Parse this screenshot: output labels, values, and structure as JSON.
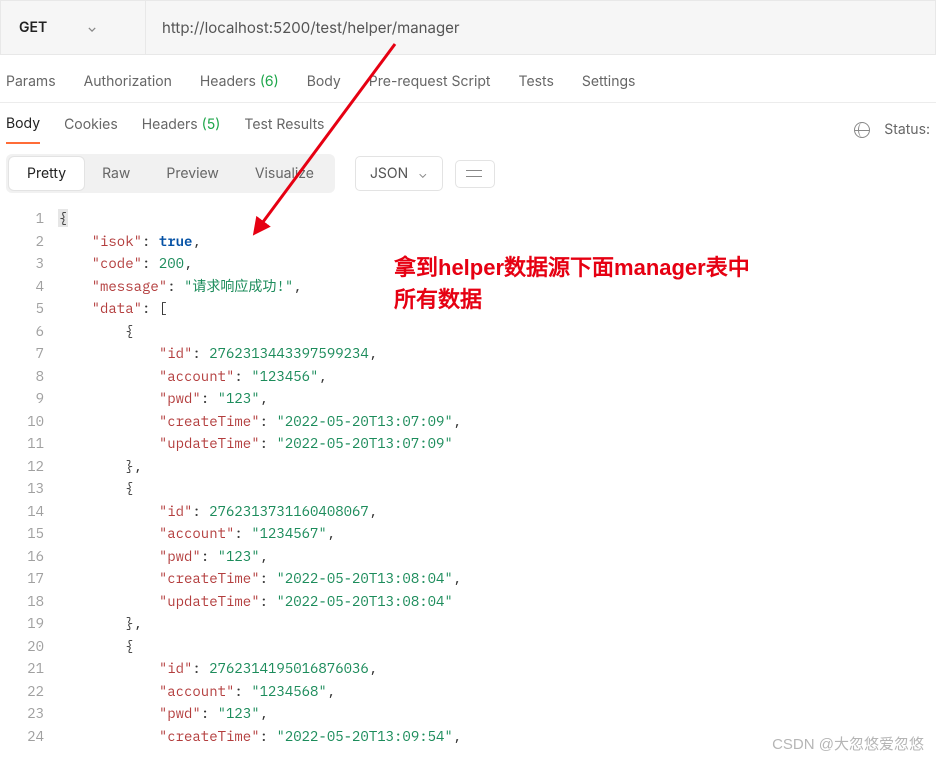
{
  "request": {
    "method": "GET",
    "url": "http://localhost:5200/test/helper/manager"
  },
  "requestTabs": {
    "params": "Params",
    "authorization": "Authorization",
    "headers": "Headers",
    "headers_count": "(6)",
    "body": "Body",
    "prerequest": "Pre-request Script",
    "tests": "Tests",
    "settings": "Settings"
  },
  "responseTabs": {
    "body": "Body",
    "cookies": "Cookies",
    "headers": "Headers",
    "headers_count": "(5)",
    "testResults": "Test Results",
    "statusLabel": "Status:"
  },
  "viewModes": {
    "pretty": "Pretty",
    "raw": "Raw",
    "preview": "Preview",
    "visualize": "Visualize",
    "format": "JSON"
  },
  "annotation": {
    "line1": "拿到helper数据源下面manager表中",
    "line2": "所有数据"
  },
  "watermark": "CSDN @大忽悠爱忽悠",
  "response_json": {
    "isok": true,
    "code": 200,
    "message": "请求响应成功!",
    "data": [
      {
        "id": 2762313443397599234,
        "account": "123456",
        "pwd": "123",
        "createTime": "2022-05-20T13:07:09",
        "updateTime": "2022-05-20T13:07:09"
      },
      {
        "id": 2762313731160408067,
        "account": "1234567",
        "pwd": "123",
        "createTime": "2022-05-20T13:08:04",
        "updateTime": "2022-05-20T13:08:04"
      },
      {
        "id": 2762314195016876036,
        "account": "1234568",
        "pwd": "123",
        "createTime": "2022-05-20T13:09:54",
        "updateTime": ""
      }
    ]
  },
  "code_lines": [
    {
      "n": 1,
      "indent": 0,
      "tokens": [
        {
          "t": "cursor",
          "v": "{"
        }
      ]
    },
    {
      "n": 2,
      "indent": 1,
      "tokens": [
        {
          "t": "key",
          "v": "\"isok\""
        },
        {
          "t": "punc",
          "v": ": "
        },
        {
          "t": "bool",
          "v": "true"
        },
        {
          "t": "punc",
          "v": ","
        }
      ]
    },
    {
      "n": 3,
      "indent": 1,
      "tokens": [
        {
          "t": "key",
          "v": "\"code\""
        },
        {
          "t": "punc",
          "v": ": "
        },
        {
          "t": "num",
          "v": "200"
        },
        {
          "t": "punc",
          "v": ","
        }
      ]
    },
    {
      "n": 4,
      "indent": 1,
      "tokens": [
        {
          "t": "key",
          "v": "\"message\""
        },
        {
          "t": "punc",
          "v": ": "
        },
        {
          "t": "str",
          "v": "\"请求响应成功!\""
        },
        {
          "t": "punc",
          "v": ","
        }
      ]
    },
    {
      "n": 5,
      "indent": 1,
      "tokens": [
        {
          "t": "key",
          "v": "\"data\""
        },
        {
          "t": "punc",
          "v": ": ["
        }
      ]
    },
    {
      "n": 6,
      "indent": 2,
      "tokens": [
        {
          "t": "punc",
          "v": "{"
        }
      ]
    },
    {
      "n": 7,
      "indent": 3,
      "tokens": [
        {
          "t": "key",
          "v": "\"id\""
        },
        {
          "t": "punc",
          "v": ": "
        },
        {
          "t": "num",
          "v": "2762313443397599234"
        },
        {
          "t": "punc",
          "v": ","
        }
      ]
    },
    {
      "n": 8,
      "indent": 3,
      "tokens": [
        {
          "t": "key",
          "v": "\"account\""
        },
        {
          "t": "punc",
          "v": ": "
        },
        {
          "t": "str",
          "v": "\"123456\""
        },
        {
          "t": "punc",
          "v": ","
        }
      ]
    },
    {
      "n": 9,
      "indent": 3,
      "tokens": [
        {
          "t": "key",
          "v": "\"pwd\""
        },
        {
          "t": "punc",
          "v": ": "
        },
        {
          "t": "str",
          "v": "\"123\""
        },
        {
          "t": "punc",
          "v": ","
        }
      ]
    },
    {
      "n": 10,
      "indent": 3,
      "tokens": [
        {
          "t": "key",
          "v": "\"createTime\""
        },
        {
          "t": "punc",
          "v": ": "
        },
        {
          "t": "str",
          "v": "\"2022-05-20T13:07:09\""
        },
        {
          "t": "punc",
          "v": ","
        }
      ]
    },
    {
      "n": 11,
      "indent": 3,
      "tokens": [
        {
          "t": "key",
          "v": "\"updateTime\""
        },
        {
          "t": "punc",
          "v": ": "
        },
        {
          "t": "str",
          "v": "\"2022-05-20T13:07:09\""
        }
      ]
    },
    {
      "n": 12,
      "indent": 2,
      "tokens": [
        {
          "t": "punc",
          "v": "},"
        }
      ]
    },
    {
      "n": 13,
      "indent": 2,
      "tokens": [
        {
          "t": "punc",
          "v": "{"
        }
      ]
    },
    {
      "n": 14,
      "indent": 3,
      "tokens": [
        {
          "t": "key",
          "v": "\"id\""
        },
        {
          "t": "punc",
          "v": ": "
        },
        {
          "t": "num",
          "v": "2762313731160408067"
        },
        {
          "t": "punc",
          "v": ","
        }
      ]
    },
    {
      "n": 15,
      "indent": 3,
      "tokens": [
        {
          "t": "key",
          "v": "\"account\""
        },
        {
          "t": "punc",
          "v": ": "
        },
        {
          "t": "str",
          "v": "\"1234567\""
        },
        {
          "t": "punc",
          "v": ","
        }
      ]
    },
    {
      "n": 16,
      "indent": 3,
      "tokens": [
        {
          "t": "key",
          "v": "\"pwd\""
        },
        {
          "t": "punc",
          "v": ": "
        },
        {
          "t": "str",
          "v": "\"123\""
        },
        {
          "t": "punc",
          "v": ","
        }
      ]
    },
    {
      "n": 17,
      "indent": 3,
      "tokens": [
        {
          "t": "key",
          "v": "\"createTime\""
        },
        {
          "t": "punc",
          "v": ": "
        },
        {
          "t": "str",
          "v": "\"2022-05-20T13:08:04\""
        },
        {
          "t": "punc",
          "v": ","
        }
      ]
    },
    {
      "n": 18,
      "indent": 3,
      "tokens": [
        {
          "t": "key",
          "v": "\"updateTime\""
        },
        {
          "t": "punc",
          "v": ": "
        },
        {
          "t": "str",
          "v": "\"2022-05-20T13:08:04\""
        }
      ]
    },
    {
      "n": 19,
      "indent": 2,
      "tokens": [
        {
          "t": "punc",
          "v": "},"
        }
      ]
    },
    {
      "n": 20,
      "indent": 2,
      "tokens": [
        {
          "t": "punc",
          "v": "{"
        }
      ]
    },
    {
      "n": 21,
      "indent": 3,
      "tokens": [
        {
          "t": "key",
          "v": "\"id\""
        },
        {
          "t": "punc",
          "v": ": "
        },
        {
          "t": "num",
          "v": "2762314195016876036"
        },
        {
          "t": "punc",
          "v": ","
        }
      ]
    },
    {
      "n": 22,
      "indent": 3,
      "tokens": [
        {
          "t": "key",
          "v": "\"account\""
        },
        {
          "t": "punc",
          "v": ": "
        },
        {
          "t": "str",
          "v": "\"1234568\""
        },
        {
          "t": "punc",
          "v": ","
        }
      ]
    },
    {
      "n": 23,
      "indent": 3,
      "tokens": [
        {
          "t": "key",
          "v": "\"pwd\""
        },
        {
          "t": "punc",
          "v": ": "
        },
        {
          "t": "str",
          "v": "\"123\""
        },
        {
          "t": "punc",
          "v": ","
        }
      ]
    },
    {
      "n": 24,
      "indent": 3,
      "tokens": [
        {
          "t": "key",
          "v": "\"createTime\""
        },
        {
          "t": "punc",
          "v": ": "
        },
        {
          "t": "str",
          "v": "\"2022-05-20T13:09:54\""
        },
        {
          "t": "punc",
          "v": ","
        }
      ]
    }
  ]
}
